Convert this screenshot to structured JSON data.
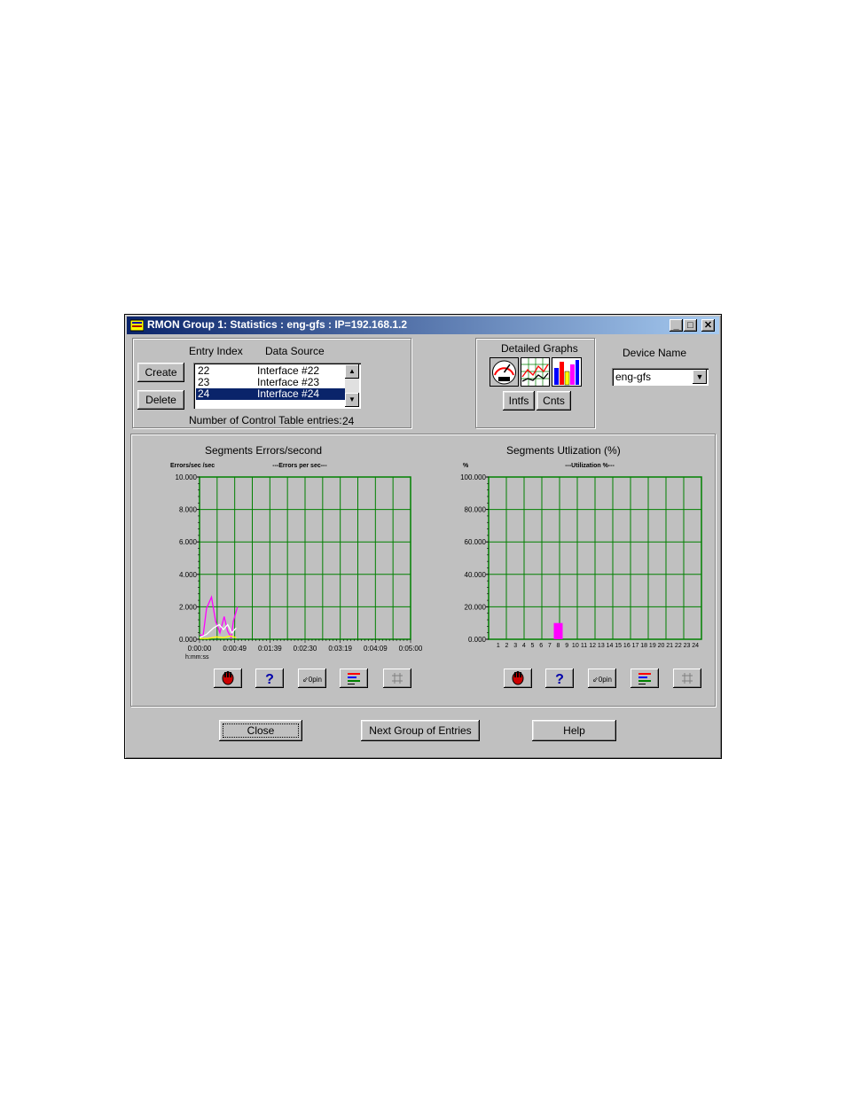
{
  "window": {
    "title": "RMON Group 1: Statistics : eng-gfs : IP=192.168.1.2",
    "minimize": "_",
    "maximize": "□",
    "close": "✕"
  },
  "control": {
    "entry_index_header": "Entry Index",
    "data_source_header": "Data Source",
    "create_label": "Create",
    "delete_label": "Delete",
    "entries": [
      {
        "index": "22",
        "source": "Interface  #22"
      },
      {
        "index": "23",
        "source": "Interface  #23"
      },
      {
        "index": "24",
        "source": "Interface  #24"
      }
    ],
    "selected_index": 2,
    "count_label": "Number of Control Table entries:",
    "count_value": "24"
  },
  "detailed_graphs": {
    "title": "Detailed Graphs",
    "intfs_label": "Intfs",
    "cnts_label": "Cnts"
  },
  "device": {
    "label": "Device Name",
    "value": "eng-gfs"
  },
  "footer": {
    "close_label": "Close",
    "next_label": "Next Group of Entries",
    "help_label": "Help"
  },
  "colors": {
    "grid": "#008000",
    "line_magenta": "#ff00ff",
    "line_white": "#ffffff",
    "line_yellow": "#ffff00",
    "bar_magenta": "#ff00ff",
    "title_start": "#0a246a",
    "title_end": "#a6caf0"
  },
  "chart_data": [
    {
      "type": "line",
      "title": "Segments Errors/second",
      "subtitle": "---Errors per sec---",
      "ylabel": "Errors/sec /sec",
      "xlabel": "h:mm:ss",
      "ylim": [
        0,
        10
      ],
      "xlim": [
        0,
        300
      ],
      "y_ticks": [
        "0.000",
        "2.000",
        "4.000",
        "6.000",
        "8.000",
        "10.000"
      ],
      "x_ticks": [
        "0:00:00",
        "0:00:49",
        "0:01:39",
        "0:02:30",
        "0:03:19",
        "0:04:09",
        "0:05:00"
      ],
      "grid": true,
      "series": [
        {
          "color": "#ff00ff",
          "points": [
            [
              0,
              0.3
            ],
            [
              5,
              0.2
            ],
            [
              10,
              1.9
            ],
            [
              17,
              2.6
            ],
            [
              23,
              1.1
            ],
            [
              29,
              0.4
            ],
            [
              35,
              1.4
            ],
            [
              40,
              0.5
            ],
            [
              45,
              0.1
            ],
            [
              48,
              1.1
            ],
            [
              54,
              2.0
            ]
          ]
        },
        {
          "color": "#ffffff",
          "points": [
            [
              0,
              0.1
            ],
            [
              10,
              0.3
            ],
            [
              20,
              0.7
            ],
            [
              28,
              0.9
            ],
            [
              34,
              0.6
            ],
            [
              40,
              0.9
            ],
            [
              46,
              0.4
            ],
            [
              52,
              0.7
            ]
          ]
        },
        {
          "color": "#ffff00",
          "points": [
            [
              0,
              0.05
            ],
            [
              12,
              0.05
            ],
            [
              24,
              0.15
            ],
            [
              34,
              0.1
            ],
            [
              44,
              0.2
            ],
            [
              52,
              0.1
            ]
          ]
        }
      ]
    },
    {
      "type": "bar",
      "title": "Segments Utlization (%)",
      "subtitle": "---Utilization %---",
      "ylabel": "%",
      "ylim": [
        0,
        100
      ],
      "y_ticks": [
        "0.000",
        "20.000",
        "40.000",
        "60.000",
        "80.000",
        "100.000"
      ],
      "categories": [
        "1",
        "2",
        "3",
        "4",
        "5",
        "6",
        "7",
        "8",
        "9",
        "10",
        "11",
        "12",
        "13",
        "14",
        "15",
        "16",
        "17",
        "18",
        "19",
        "20",
        "21",
        "22",
        "23",
        "24"
      ],
      "values": [
        0,
        0,
        0,
        0,
        0,
        0,
        0,
        10,
        0,
        0,
        0,
        0,
        0,
        0,
        0,
        0,
        0,
        0,
        0,
        0,
        0,
        0,
        0,
        0
      ],
      "grid": true,
      "color": "#ff00ff"
    }
  ]
}
